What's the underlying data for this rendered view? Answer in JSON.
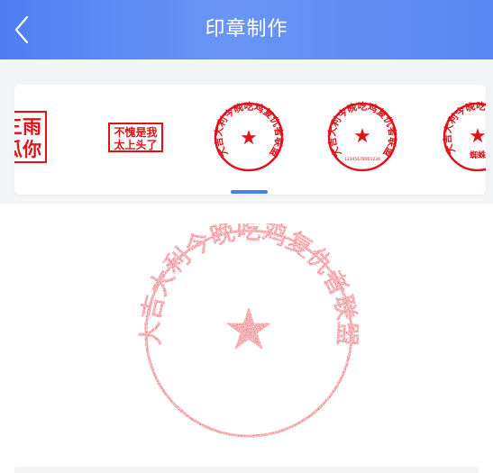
{
  "header": {
    "title": "印章制作"
  },
  "templates": {
    "partial_square": {
      "line1": "三雨",
      "line2": "瓜你"
    },
    "rect_stamp": {
      "line1": "不愧是我",
      "line2": "太上头了"
    },
    "round_stamp_1": {
      "arc_text": "大吉大利今晚吃鸡复仇者联盟"
    },
    "round_stamp_2": {
      "arc_text": "大吉大利今晚吃鸡复仇者联盟",
      "bottom_code": "12345678901234"
    },
    "round_stamp_3": {
      "arc_text": "大吉大利今晚吃鸡",
      "bottom_text": "蜘蛛"
    }
  },
  "preview": {
    "arc_text": "大吉大利今晚吃鸡复仇者联盟",
    "center_symbol": "★"
  },
  "colors": {
    "stamp_red": "#e0121a",
    "preview_red": "#e8323c",
    "accent_blue": "#4a7ef5"
  }
}
